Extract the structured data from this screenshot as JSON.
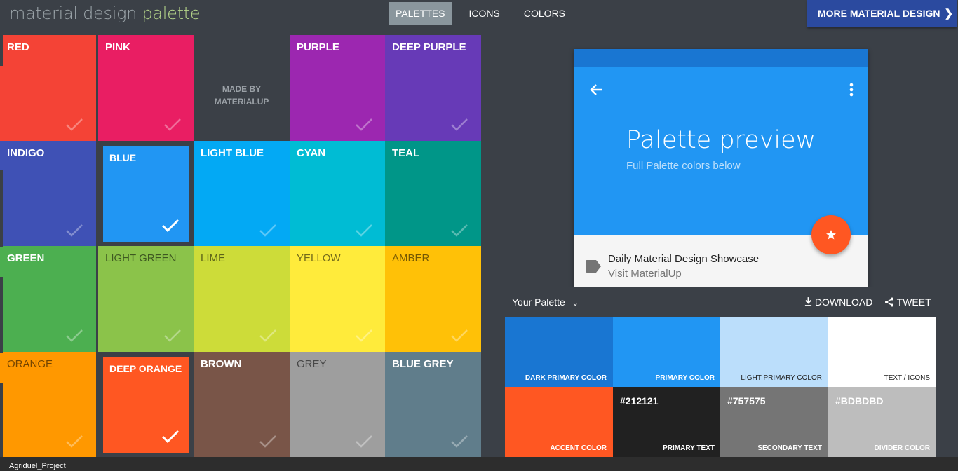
{
  "header": {
    "logo_main": "material design",
    "logo_accent": "palette",
    "nav": [
      "PALETTES",
      "ICONS",
      "COLORS"
    ],
    "more_label": "MORE MATERIAL DESIGN",
    "more_icon": "chevron-right-icon"
  },
  "colors": {
    "red": "#f44336",
    "pink": "#e91e63",
    "purple": "#9c27b0",
    "deep_purple": "#673ab7",
    "indigo": "#3f51b5",
    "blue": "#2196f3",
    "light_blue": "#03a9f4",
    "cyan": "#00bcd4",
    "teal": "#009688",
    "green": "#4caf50",
    "light_green": "#8bc34a",
    "lime": "#cddc39",
    "yellow": "#ffeb3b",
    "amber": "#ffc107",
    "orange": "#ff9800",
    "deep_orange": "#ff5722",
    "brown": "#795548",
    "grey": "#9e9e9e",
    "blue_grey": "#607d8b"
  },
  "grid": {
    "made_by": "MADE BY MATERIALUP",
    "tiles": [
      "RED",
      "PINK",
      "PURPLE",
      "DEEP PURPLE",
      "INDIGO",
      "BLUE",
      "LIGHT BLUE",
      "CYAN",
      "TEAL",
      "GREEN",
      "LIGHT GREEN",
      "LIME",
      "YELLOW",
      "AMBER",
      "ORANGE",
      "DEEP ORANGE",
      "BROWN",
      "GREY",
      "BLUE GREY"
    ],
    "selected": [
      "BLUE",
      "DEEP ORANGE"
    ]
  },
  "preview": {
    "title": "Palette preview",
    "subtitle": "Full Palette colors below",
    "list_title": "Daily Material Design Showcase",
    "list_sub": "Visit MaterialUp"
  },
  "palette": {
    "title": "Your Palette",
    "download": "DOWNLOAD",
    "tweet": "TWEET",
    "swatches": [
      {
        "label": "DARK PRIMARY COLOR",
        "color": "#1976d2"
      },
      {
        "label": "PRIMARY COLOR",
        "color": "#2196f3"
      },
      {
        "label": "LIGHT PRIMARY COLOR",
        "color": "#bbdefb"
      },
      {
        "label": "TEXT / ICONS",
        "color": "#ffffff"
      },
      {
        "label": "ACCENT COLOR",
        "color": "#ff5722"
      },
      {
        "label": "PRIMARY TEXT",
        "color": "#212121",
        "hex": "#212121"
      },
      {
        "label": "SECONDARY TEXT",
        "color": "#757575",
        "hex": "#757575"
      },
      {
        "label": "DIVIDER COLOR",
        "color": "#bdbdbd",
        "hex": "#BDBDBD"
      }
    ]
  },
  "footer": {
    "text": "Agriduel_Project"
  }
}
